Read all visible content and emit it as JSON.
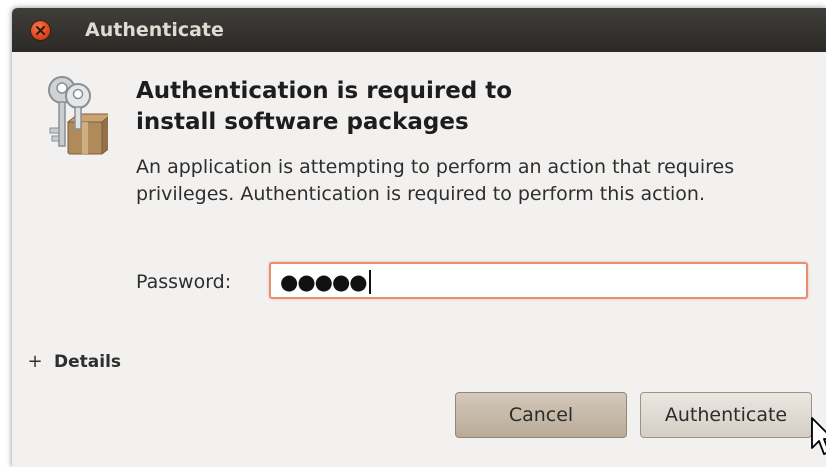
{
  "window": {
    "title": "Authenticate"
  },
  "dialog": {
    "heading_line1": "Authentication is required to",
    "heading_line2": "install software packages",
    "message": "An application is attempting to perform an action that requires privileges. Authentication is required to perform this action.",
    "password_label": "Password:",
    "password_masked": "●●●●●",
    "details_expander": "+",
    "details_label": "Details"
  },
  "buttons": {
    "cancel": "Cancel",
    "authenticate": "Authenticate"
  },
  "icons": {
    "dialog": "keys-icon",
    "close": "close-icon",
    "pointer": "mouse-pointer-icon"
  },
  "colors": {
    "titlebar": "#3c3b37",
    "focus_border": "#ea8f6e",
    "close_button": "#df4a1f"
  }
}
